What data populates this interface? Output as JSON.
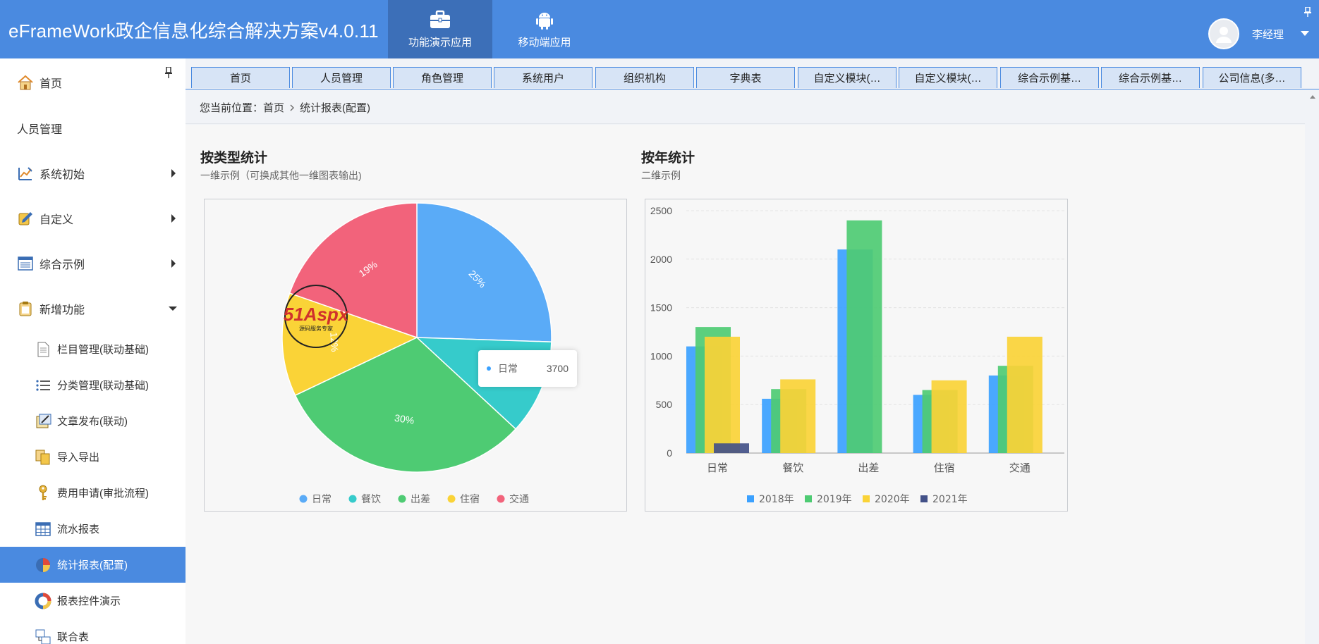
{
  "app": {
    "title": "eFrameWork政企信息化综合解决方案v4.0.11"
  },
  "top_nav": [
    {
      "label": "功能演示应用",
      "icon": "briefcase-icon",
      "active": true
    },
    {
      "label": "移动端应用",
      "icon": "android-icon",
      "active": false
    }
  ],
  "user": {
    "name": "李经理"
  },
  "sidebar": {
    "items": [
      {
        "label": "首页",
        "icon": "home-icon"
      },
      {
        "label": "人员管理",
        "icon": ""
      },
      {
        "label": "系统初始",
        "icon": "settings-chart-icon",
        "arrow": "right"
      },
      {
        "label": "自定义",
        "icon": "custom-icon",
        "arrow": "right"
      },
      {
        "label": "综合示例",
        "icon": "form-icon",
        "arrow": "right"
      },
      {
        "label": "新增功能",
        "icon": "clipboard-icon",
        "arrow": "down"
      }
    ],
    "sub_items": [
      {
        "label": "栏目管理(联动基础)",
        "icon": "document-icon",
        "active": false
      },
      {
        "label": "分类管理(联动基础)",
        "icon": "list-icon",
        "active": false
      },
      {
        "label": "文章发布(联动)",
        "icon": "edit-doc-icon",
        "active": false
      },
      {
        "label": "导入导出",
        "icon": "copy-icon",
        "active": false
      },
      {
        "label": "费用申请(审批流程)",
        "icon": "key-icon",
        "active": false
      },
      {
        "label": "流水报表",
        "icon": "table-icon",
        "active": false
      },
      {
        "label": "统计报表(配置)",
        "icon": "pie-chart-icon",
        "active": true
      },
      {
        "label": "报表控件演示",
        "icon": "donut-chart-icon",
        "active": false
      },
      {
        "label": "联合表",
        "icon": "join-table-icon",
        "active": false
      }
    ]
  },
  "tabs": [
    "首页",
    "人员管理",
    "角色管理",
    "系统用户",
    "组织机构",
    "字典表",
    "自定义模块(…",
    "自定义模块(…",
    "综合示例基…",
    "综合示例基…",
    "公司信息(多…"
  ],
  "breadcrumb": {
    "prefix": "您当前位置：",
    "items": [
      "首页",
      "统计报表(配置)"
    ]
  },
  "panels": {
    "left": {
      "title": "按类型统计",
      "subtitle": "一维示例（可换成其他一维图表输出)"
    },
    "right": {
      "title": "按年统计",
      "subtitle": "二维示例"
    }
  },
  "watermark": {
    "text": "51Aspx",
    "subtext": "源码服务专家"
  },
  "tooltip": {
    "label": "日常",
    "value": "3700"
  },
  "colors": {
    "header": "#4a8ae0",
    "active": "#4a8ae0"
  },
  "chart_data": [
    {
      "type": "pie",
      "categories": [
        "日常",
        "餐饮",
        "出差",
        "住宿",
        "交通"
      ],
      "values": [
        3700,
        1650,
        4500,
        1800,
        2850
      ],
      "slice_labels": [
        "25%",
        "",
        "30%",
        "12%",
        "19%"
      ],
      "colors": [
        "#5aabf7",
        "#36cbcb",
        "#4ecb73",
        "#fad337",
        "#f2637b"
      ],
      "legend": "bottom"
    },
    {
      "type": "bar",
      "categories": [
        "日常",
        "餐饮",
        "出差",
        "住宿",
        "交通"
      ],
      "series": [
        {
          "name": "2018年",
          "values": [
            1100,
            560,
            2100,
            600,
            800
          ],
          "color": "#3ba1ff"
        },
        {
          "name": "2019年",
          "values": [
            1300,
            660,
            2400,
            650,
            900
          ],
          "color": "#4ecb73"
        },
        {
          "name": "2020年",
          "values": [
            1200,
            760,
            0,
            750,
            1200
          ],
          "color": "#fad337"
        },
        {
          "name": "2021年",
          "values": [
            100,
            0,
            0,
            0,
            0
          ],
          "color": "#435188"
        }
      ],
      "ylim": [
        0,
        2500
      ],
      "yticks": [
        "0",
        "500",
        "1000",
        "1500",
        "2000",
        "2500"
      ],
      "grid": true,
      "legend": "bottom"
    }
  ]
}
